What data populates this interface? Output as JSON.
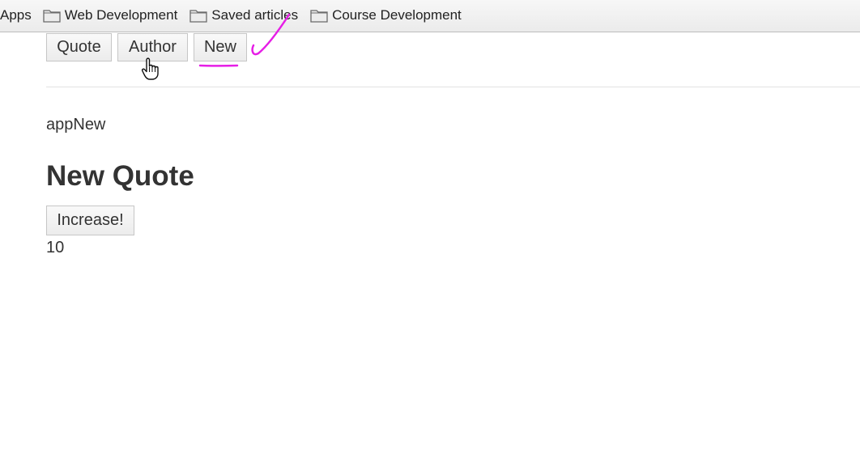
{
  "bookmarks_bar": {
    "apps_label": "Apps",
    "items": [
      {
        "label": "Web Development",
        "icon": "folder-icon"
      },
      {
        "label": "Saved articles",
        "icon": "folder-icon"
      },
      {
        "label": "Course Development",
        "icon": "folder-icon"
      }
    ]
  },
  "nav": {
    "buttons": [
      {
        "label": "Quote"
      },
      {
        "label": "Author"
      },
      {
        "label": "New"
      }
    ]
  },
  "main": {
    "component_label": "appNew",
    "heading": "New Quote",
    "increase_button_label": "Increase!",
    "counter_value": "10"
  },
  "annotation": {
    "color": "#e61ee6",
    "marks": [
      "checkmark",
      "underline-new-button"
    ]
  },
  "cursor": {
    "type": "hand-pointer-icon",
    "over": "Author"
  }
}
